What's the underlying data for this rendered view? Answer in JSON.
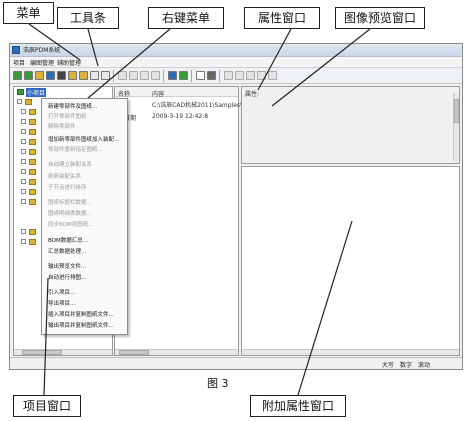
{
  "callouts": {
    "menu": "菜单",
    "toolbar": "工具条",
    "context_menu": "右键菜单",
    "property_window": "属性窗口",
    "preview_window": "图像预览窗口",
    "project_window": "项目窗口",
    "extra_property_window": "附加属性窗口"
  },
  "window": {
    "title": "浩辰PDM系统",
    "menu": [
      "项目",
      "编图管理",
      "辅助管理"
    ]
  },
  "tree": {
    "root_label": "小项目"
  },
  "list": {
    "columns": [
      "名称",
      "内容"
    ],
    "rows": [
      {
        "name": "",
        "value": "C:\\浩辰CAD机械2011\\Samples\\"
      },
      {
        "name": "改日期",
        "value": "2009-3-19 12:42:8"
      }
    ]
  },
  "property": {
    "header": "属性:"
  },
  "context_menu": {
    "items": [
      {
        "label": "新建零部件及图纸...",
        "enabled": true
      },
      {
        "label": "打开零部件图纸",
        "enabled": false
      },
      {
        "label": "删除零部件",
        "enabled": false
      },
      {
        "label": "增加新零部件图纸加入装配...",
        "enabled": true
      },
      {
        "label": "零部件重新指定图纸...",
        "enabled": false
      },
      {
        "label": "自动建立装配关系",
        "enabled": false
      },
      {
        "label": "刷新装配关系",
        "enabled": false
      },
      {
        "label": "子节点进行排序",
        "enabled": false
      },
      {
        "label": "图纸标题栏数据...",
        "enabled": false
      },
      {
        "label": "图纸明细表数据...",
        "enabled": false
      },
      {
        "label": "同步BOM到图纸...",
        "enabled": false
      },
      {
        "label": "BOM数据汇总...",
        "enabled": true
      },
      {
        "label": "汇总数据处理...",
        "enabled": true
      },
      {
        "label": "输出预览文件...",
        "enabled": true
      },
      {
        "label": "自动进行排图...",
        "enabled": true
      },
      {
        "label": "引入项目...",
        "enabled": true
      },
      {
        "label": "导出项目...",
        "enabled": true
      },
      {
        "label": "插入项目并复制图纸文件...",
        "enabled": true
      },
      {
        "label": "输出项目并复制图纸文件...",
        "enabled": true
      }
    ]
  },
  "status": {
    "caps": "大写",
    "num": "数字",
    "scroll": "滚动"
  },
  "figure_caption": "图 3",
  "colors": {
    "toolbar_icon_green": "#3a9a3a",
    "toolbar_icon_yellow": "#d8b23a",
    "toolbar_icon_blue": "#2e6db4"
  }
}
